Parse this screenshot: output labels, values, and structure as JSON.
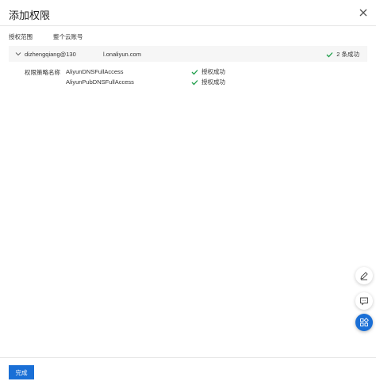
{
  "dialog": {
    "title": "添加权限"
  },
  "scope": {
    "label": "授权范围",
    "value": "整个云账号"
  },
  "account": {
    "name": "dizhengqiang@130",
    "domain": "l.onaliyun.com",
    "status": "2 条成功"
  },
  "policies": {
    "label": "权限策略名称",
    "items": [
      {
        "name": "AliyunDNSFullAccess",
        "status": "授权成功"
      },
      {
        "name": "AliyunPubDNSFullAccess",
        "status": "授权成功"
      }
    ]
  },
  "footer": {
    "done_label": "完成"
  },
  "colors": {
    "primary": "#1a6fd6",
    "success": "#1e9e4a"
  },
  "icons": [
    "close-icon",
    "chevron-down-icon",
    "check-icon",
    "edit-icon",
    "feedback-icon",
    "apps-icon"
  ]
}
